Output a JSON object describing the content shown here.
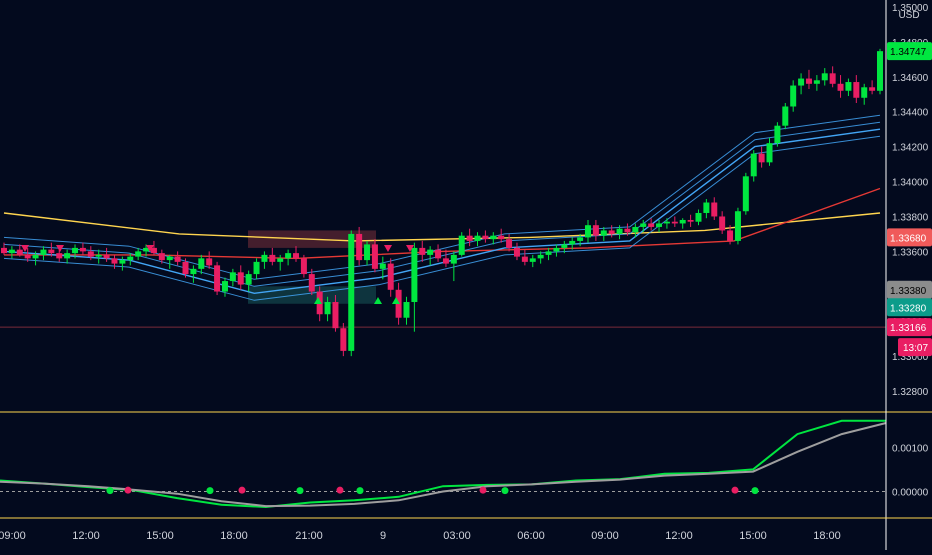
{
  "currency": "USD",
  "price_axis": {
    "ticks": [
      "1.35000",
      "1.34800",
      "1.34600",
      "1.34400",
      "1.34200",
      "1.34000",
      "1.33800",
      "1.33600",
      "1.33400",
      "1.33200",
      "1.33000",
      "1.32800"
    ],
    "range": [
      1.3268,
      1.3504
    ]
  },
  "price_badges": [
    {
      "label": "1.34747",
      "value": 1.34747,
      "bg": "#00e640",
      "fg": "#000000"
    },
    {
      "label": "1.33680",
      "value": 1.3368,
      "bg": "#f05a5a",
      "fg": "#ffffff"
    },
    {
      "label": "1.33380",
      "value": 1.3338,
      "bg": "#8c8c8c",
      "fg": "#000000"
    },
    {
      "label": "1.33280",
      "value": 1.3328,
      "bg": "#0c9c8a",
      "fg": "#ffffff"
    },
    {
      "label": "1.33166",
      "value": 1.33166,
      "bg": "#e91e63",
      "fg": "#ffffff"
    }
  ],
  "countdown": {
    "label": "13:07",
    "bg": "#e91e63"
  },
  "time_axis": {
    "labels": [
      "09:00",
      "12:00",
      "15:00",
      "18:00",
      "21:00",
      "9",
      "03:00",
      "06:00",
      "09:00",
      "12:00",
      "15:00",
      "18:00"
    ]
  },
  "oscillator_axis": {
    "ticks": [
      "0.00100",
      "0.00000"
    ],
    "range": [
      -0.0006,
      0.0018
    ]
  },
  "colors": {
    "background": "#030a1e",
    "bull": "#00e640",
    "bear": "#e91e63",
    "ma_yellow": "#ffd54f",
    "ma_red": "#e53935",
    "ma_blue": "#42a5f5",
    "osc_green": "#00e640",
    "osc_gray": "#9e9e9e"
  },
  "chart_data": [
    {
      "type": "candlestick",
      "x_unit": "15m bars",
      "ylim": [
        1.3268,
        1.3504
      ],
      "candles_ohlc": [
        [
          1.3362,
          1.3365,
          1.3358,
          1.3359
        ],
        [
          1.3359,
          1.3363,
          1.3356,
          1.3361
        ],
        [
          1.3361,
          1.3364,
          1.3357,
          1.3358
        ],
        [
          1.3358,
          1.3362,
          1.3354,
          1.3356
        ],
        [
          1.3356,
          1.336,
          1.3352,
          1.3358
        ],
        [
          1.3358,
          1.3363,
          1.3355,
          1.3361
        ],
        [
          1.3361,
          1.3365,
          1.3357,
          1.3359
        ],
        [
          1.3359,
          1.3362,
          1.3354,
          1.3356
        ],
        [
          1.3356,
          1.3361,
          1.3353,
          1.3359
        ],
        [
          1.3359,
          1.3364,
          1.3356,
          1.3362
        ],
        [
          1.3362,
          1.3365,
          1.3358,
          1.336
        ],
        [
          1.336,
          1.3363,
          1.3355,
          1.3357
        ],
        [
          1.3357,
          1.3361,
          1.3353,
          1.3358
        ],
        [
          1.3358,
          1.3362,
          1.3354,
          1.3356
        ],
        [
          1.3356,
          1.3358,
          1.335,
          1.3353
        ],
        [
          1.3353,
          1.3357,
          1.3349,
          1.3355
        ],
        [
          1.3355,
          1.3359,
          1.3352,
          1.3357
        ],
        [
          1.3357,
          1.3362,
          1.3355,
          1.336
        ],
        [
          1.336,
          1.3364,
          1.3357,
          1.3362
        ],
        [
          1.3362,
          1.3366,
          1.3358,
          1.3359
        ],
        [
          1.3359,
          1.3361,
          1.3353,
          1.3355
        ],
        [
          1.3355,
          1.3358,
          1.335,
          1.3357
        ],
        [
          1.3357,
          1.336,
          1.3352,
          1.3354
        ],
        [
          1.3354,
          1.3356,
          1.3345,
          1.3347
        ],
        [
          1.3347,
          1.3352,
          1.3342,
          1.335
        ],
        [
          1.335,
          1.3358,
          1.3347,
          1.3356
        ],
        [
          1.3356,
          1.336,
          1.335,
          1.3352
        ],
        [
          1.3352,
          1.3354,
          1.3335,
          1.3337
        ],
        [
          1.3337,
          1.3345,
          1.3334,
          1.3343
        ],
        [
          1.3343,
          1.335,
          1.334,
          1.3348
        ],
        [
          1.3348,
          1.3352,
          1.3338,
          1.3341
        ],
        [
          1.3341,
          1.3349,
          1.3337,
          1.3347
        ],
        [
          1.3347,
          1.3356,
          1.3344,
          1.3354
        ],
        [
          1.3354,
          1.336,
          1.335,
          1.3358
        ],
        [
          1.3358,
          1.3362,
          1.3352,
          1.3354
        ],
        [
          1.3354,
          1.3358,
          1.3349,
          1.3356
        ],
        [
          1.3356,
          1.3361,
          1.3352,
          1.3359
        ],
        [
          1.3359,
          1.3363,
          1.3354,
          1.3356
        ],
        [
          1.3356,
          1.3358,
          1.3345,
          1.3347
        ],
        [
          1.3347,
          1.335,
          1.3335,
          1.3337
        ],
        [
          1.3337,
          1.334,
          1.332,
          1.3324
        ],
        [
          1.3324,
          1.3334,
          1.332,
          1.3331
        ],
        [
          1.3331,
          1.3335,
          1.3314,
          1.3316
        ],
        [
          1.3316,
          1.3319,
          1.33,
          1.3303
        ],
        [
          1.3303,
          1.3372,
          1.33,
          1.337
        ],
        [
          1.337,
          1.3374,
          1.3352,
          1.3355
        ],
        [
          1.3355,
          1.3366,
          1.3352,
          1.3364
        ],
        [
          1.3364,
          1.3367,
          1.3348,
          1.335
        ],
        [
          1.335,
          1.3357,
          1.3344,
          1.3353
        ],
        [
          1.3353,
          1.3356,
          1.3334,
          1.3338
        ],
        [
          1.3338,
          1.3342,
          1.3318,
          1.3322
        ],
        [
          1.3322,
          1.3334,
          1.3318,
          1.3331
        ],
        [
          1.3331,
          1.3365,
          1.3314,
          1.3362
        ],
        [
          1.3362,
          1.3366,
          1.3354,
          1.3358
        ],
        [
          1.3358,
          1.3363,
          1.3352,
          1.3361
        ],
        [
          1.3361,
          1.3364,
          1.3354,
          1.3356
        ],
        [
          1.3356,
          1.3361,
          1.3351,
          1.3353
        ],
        [
          1.3353,
          1.336,
          1.3343,
          1.3358
        ],
        [
          1.3358,
          1.3371,
          1.3357,
          1.3369
        ],
        [
          1.3369,
          1.3373,
          1.3363,
          1.3366
        ],
        [
          1.3366,
          1.3371,
          1.3363,
          1.3369
        ],
        [
          1.3369,
          1.3372,
          1.3365,
          1.3367
        ],
        [
          1.3367,
          1.3371,
          1.3364,
          1.3369
        ],
        [
          1.3369,
          1.3373,
          1.3365,
          1.3367
        ],
        [
          1.3367,
          1.337,
          1.336,
          1.3362
        ],
        [
          1.3362,
          1.3365,
          1.3355,
          1.3357
        ],
        [
          1.3357,
          1.3361,
          1.3352,
          1.3354
        ],
        [
          1.3354,
          1.3358,
          1.3351,
          1.3356
        ],
        [
          1.3356,
          1.336,
          1.3353,
          1.3358
        ],
        [
          1.3358,
          1.3362,
          1.3355,
          1.336
        ],
        [
          1.336,
          1.3364,
          1.3357,
          1.3362
        ],
        [
          1.3362,
          1.3366,
          1.3359,
          1.3364
        ],
        [
          1.3364,
          1.3368,
          1.3361,
          1.3366
        ],
        [
          1.3366,
          1.337,
          1.3363,
          1.3368
        ],
        [
          1.3368,
          1.3378,
          1.3365,
          1.3375
        ],
        [
          1.3375,
          1.3378,
          1.3366,
          1.3369
        ],
        [
          1.3369,
          1.3374,
          1.3366,
          1.3372
        ],
        [
          1.3372,
          1.3375,
          1.3368,
          1.337
        ],
        [
          1.337,
          1.3375,
          1.3367,
          1.3373
        ],
        [
          1.3373,
          1.3376,
          1.3369,
          1.3371
        ],
        [
          1.3371,
          1.3376,
          1.3368,
          1.3374
        ],
        [
          1.3374,
          1.3378,
          1.3371,
          1.3376
        ],
        [
          1.3376,
          1.3379,
          1.3372,
          1.3374
        ],
        [
          1.3374,
          1.3378,
          1.3371,
          1.3376
        ],
        [
          1.3376,
          1.3379,
          1.3373,
          1.3377
        ],
        [
          1.3377,
          1.338,
          1.3374,
          1.3376
        ],
        [
          1.3376,
          1.3379,
          1.3373,
          1.3378
        ],
        [
          1.3378,
          1.3381,
          1.3374,
          1.3377
        ],
        [
          1.3377,
          1.3384,
          1.3375,
          1.3382
        ],
        [
          1.3382,
          1.339,
          1.3379,
          1.3388
        ],
        [
          1.3388,
          1.3391,
          1.3378,
          1.338
        ],
        [
          1.338,
          1.3383,
          1.337,
          1.3372
        ],
        [
          1.3372,
          1.3375,
          1.3364,
          1.3366
        ],
        [
          1.3366,
          1.3385,
          1.3364,
          1.3383
        ],
        [
          1.3383,
          1.3405,
          1.3381,
          1.3403
        ],
        [
          1.3403,
          1.3418,
          1.34,
          1.3416
        ],
        [
          1.3416,
          1.342,
          1.3408,
          1.3411
        ],
        [
          1.3411,
          1.3425,
          1.3409,
          1.3422
        ],
        [
          1.3422,
          1.3434,
          1.342,
          1.3432
        ],
        [
          1.3432,
          1.3445,
          1.343,
          1.3443
        ],
        [
          1.3443,
          1.3458,
          1.344,
          1.3455
        ],
        [
          1.3455,
          1.3462,
          1.345,
          1.3459
        ],
        [
          1.3459,
          1.3464,
          1.3453,
          1.3456
        ],
        [
          1.3456,
          1.3461,
          1.3452,
          1.3458
        ],
        [
          1.3458,
          1.3465,
          1.3455,
          1.3462
        ],
        [
          1.3462,
          1.3466,
          1.3454,
          1.3456
        ],
        [
          1.3456,
          1.3461,
          1.3448,
          1.3452
        ],
        [
          1.3452,
          1.3459,
          1.3449,
          1.3457
        ],
        [
          1.3457,
          1.3461,
          1.3445,
          1.3448
        ],
        [
          1.3448,
          1.3456,
          1.3444,
          1.3454
        ],
        [
          1.3454,
          1.3458,
          1.345,
          1.3452
        ],
        [
          1.3452,
          1.3476,
          1.345,
          1.34747
        ]
      ],
      "moving_averages": [
        {
          "color": "yellow",
          "start": 1.3382,
          "end": 1.3382,
          "path": [
            1.3382,
            1.337,
            1.3366,
            1.3368,
            1.3372,
            1.3382
          ]
        },
        {
          "color": "red",
          "path": [
            1.3358,
            1.3358,
            1.3356,
            1.336,
            1.3362,
            1.3366,
            1.3396
          ]
        },
        {
          "color": "blue",
          "path": [
            1.336,
            1.3355,
            1.3336,
            1.3345,
            1.3362,
            1.3366,
            1.342,
            1.343
          ]
        }
      ],
      "signals": [
        "buy arrows (green triangles)",
        "sell arrows (red triangles)"
      ],
      "horizontal_levels": [
        1.33166
      ]
    },
    {
      "type": "line",
      "ylim": [
        -0.0006,
        0.0018
      ],
      "series": [
        {
          "color": "green",
          "values": [
            0.00025,
            0.00018,
            0.0001,
            3e-05,
            -0.00015,
            -0.0003,
            -0.00035,
            -0.00025,
            -0.0002,
            -0.00012,
            0.00012,
            0.00015,
            0.00016,
            0.00025,
            0.00028,
            0.0004,
            0.00042,
            0.0005,
            0.0013,
            0.0016,
            0.0016
          ]
        },
        {
          "color": "gray",
          "values": [
            0.00022,
            0.00018,
            0.00012,
            4e-05,
            -5e-05,
            -0.00022,
            -0.00033,
            -0.00032,
            -0.00028,
            -0.0002,
            0.0,
            0.00012,
            0.00016,
            0.00022,
            0.00027,
            0.00036,
            0.0004,
            0.00045,
            0.0009,
            0.0013,
            0.00155
          ]
        }
      ]
    }
  ]
}
